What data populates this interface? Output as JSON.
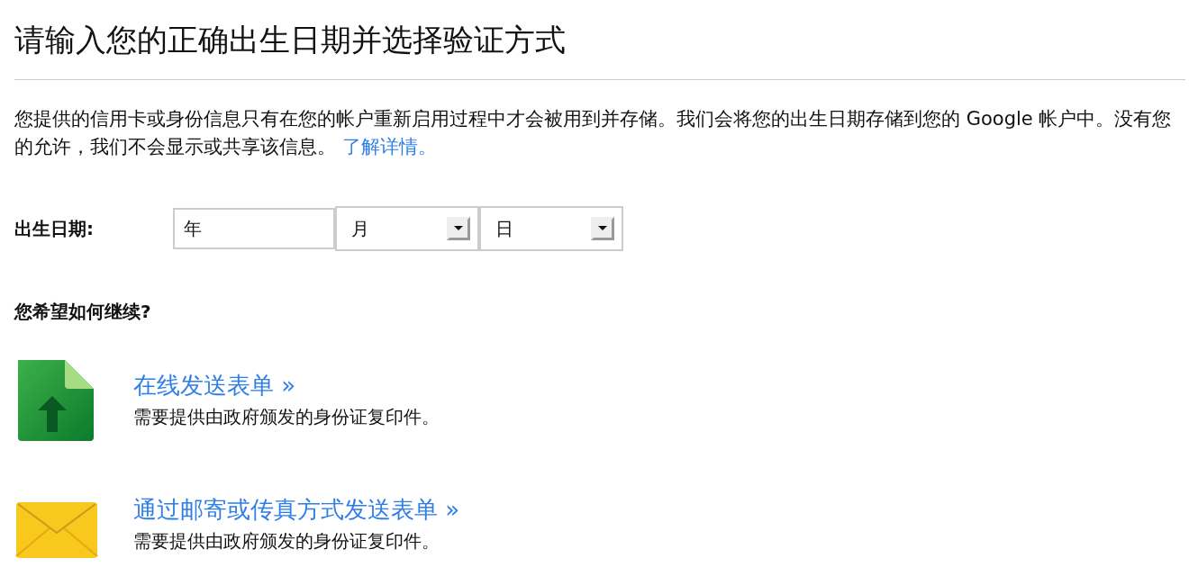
{
  "heading": "请输入您的正确出生日期并选择验证方式",
  "intro": {
    "text": "您提供的信用卡或身份信息只有在您的帐户重新启用过程中才会被用到并存储。我们会将您的出生日期存储到您的 Google 帐户中。没有您的允许，我们不会显示或共享该信息。",
    "link": "了解详情。"
  },
  "birth_date": {
    "label": "出生日期:",
    "year": {
      "placeholder": "年"
    },
    "month": {
      "value": "月"
    },
    "day": {
      "value": "日"
    }
  },
  "question": "您希望如何继续?",
  "options": [
    {
      "kind": "upload",
      "link": "在线发送表单 »",
      "note": "需要提供由政府颁发的身份证复印件。"
    },
    {
      "kind": "mail",
      "link": "通过邮寄或传真方式发送表单 »",
      "note": "需要提供由政府颁发的身份证复印件。"
    }
  ]
}
